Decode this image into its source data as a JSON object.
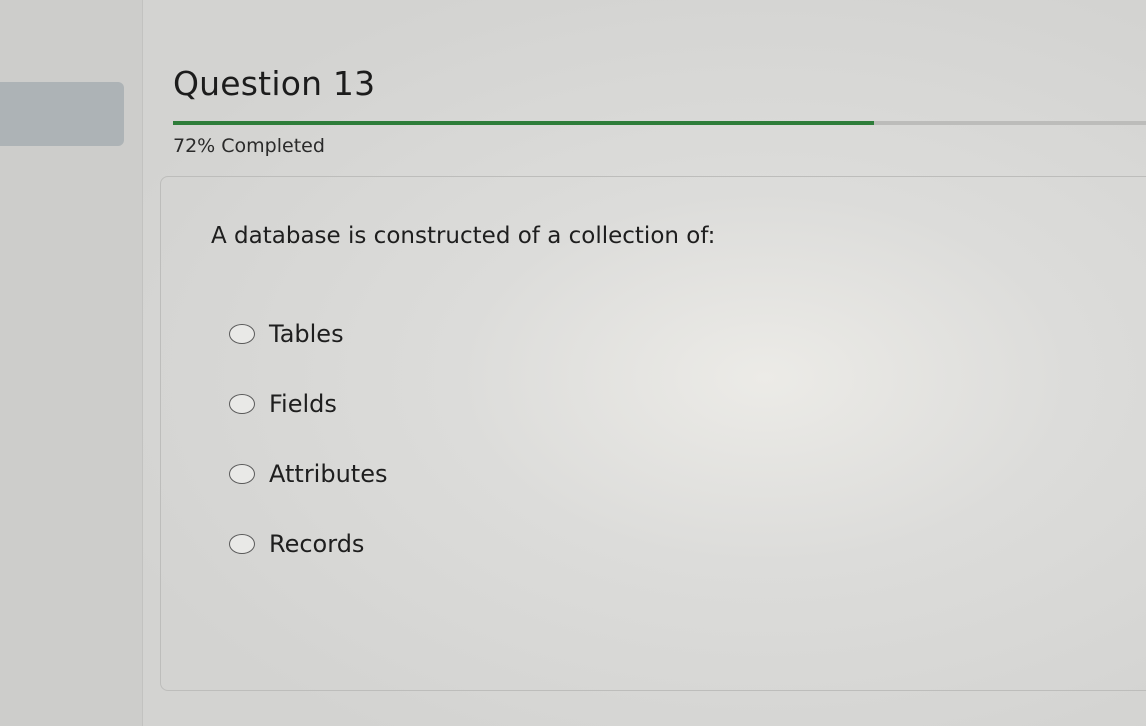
{
  "question": {
    "title": "Question 13",
    "progress_fraction": 0.72,
    "progress_text": "72% Completed",
    "prompt": "A database is constructed of a collection of:",
    "options": [
      {
        "label": "Tables"
      },
      {
        "label": "Fields"
      },
      {
        "label": "Attributes"
      },
      {
        "label": "Records"
      }
    ]
  },
  "colors": {
    "progress_accent": "#2e7d3a"
  }
}
